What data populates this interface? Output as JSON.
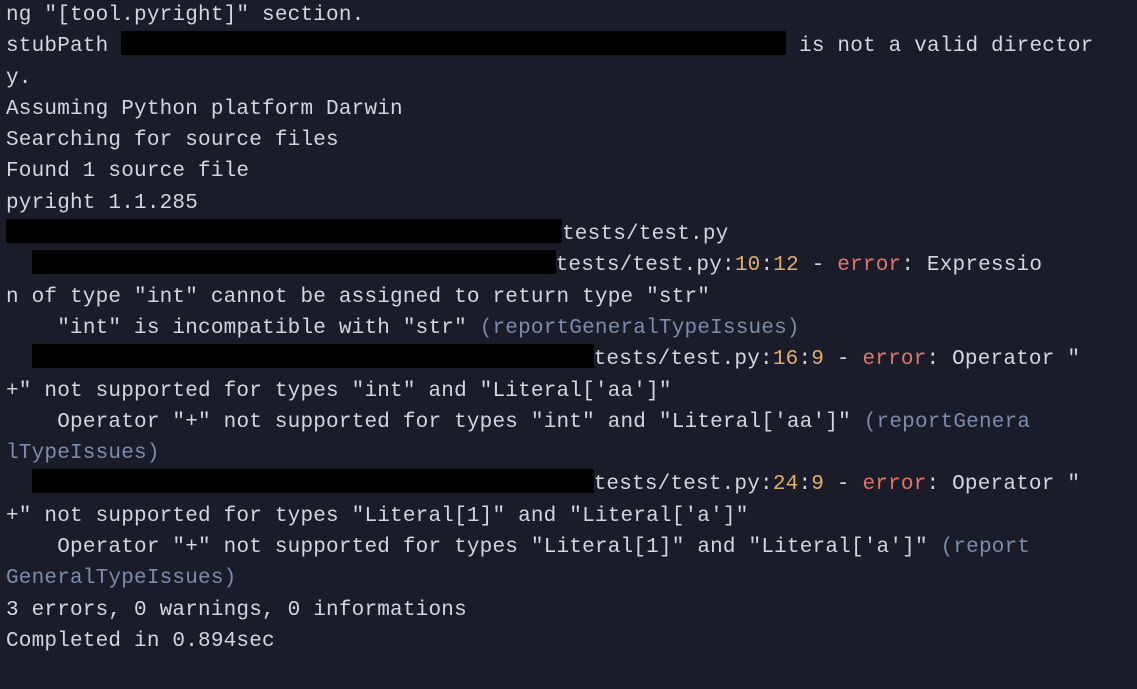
{
  "intro": {
    "line1_a": "ng \"[tool.pyright]\" section.",
    "line2_a": "stubPath ",
    "line2_b": " is not a valid director",
    "line3": "y.",
    "line4": "Assuming Python platform Darwin",
    "line5": "Searching for source files",
    "line6": "Found 1 source file",
    "line7": "pyright 1.1.285"
  },
  "diag": {
    "file_tail": "tests/test.py",
    "sep_colon": ":",
    "dash": " - ",
    "error_kw": "error",
    "colon_after_err": ": ",
    "rule": "(reportGeneralTypeIssues)",
    "d1": {
      "line": "10",
      "col": "12",
      "msg_a": "Expressio",
      "msg_b": "n of type \"int\" cannot be assigned to return type \"str\"",
      "detail_a": "    \"int\" is incompatible with \"str\" "
    },
    "d2": {
      "line": "16",
      "col": "9",
      "msg_a": "Operator \"",
      "msg_b": "+\" not supported for types \"int\" and \"Literal['aa']\"",
      "detail_a": "    Operator \"+\" not supported for types \"int\" and \"Literal['aa']\" ",
      "rule_a": "(reportGenera",
      "rule_b": "lTypeIssues)"
    },
    "d3": {
      "line": "24",
      "col": "9",
      "msg_a": "Operator \"",
      "msg_b": "+\" not supported for types \"Literal[1]\" and \"Literal['a']\"",
      "detail_a": "    Operator \"+\" not supported for types \"Literal[1]\" and \"Literal['a']\" ",
      "rule_a": "(report",
      "rule_b": "GeneralTypeIssues)"
    }
  },
  "summary": {
    "counts": "3 errors, 0 warnings, 0 informations",
    "time": "Completed in 0.894sec"
  },
  "redact_widths": {
    "stubpath": "665",
    "header": "556",
    "diag1": "524",
    "diag2": "562",
    "diag3": "562"
  }
}
